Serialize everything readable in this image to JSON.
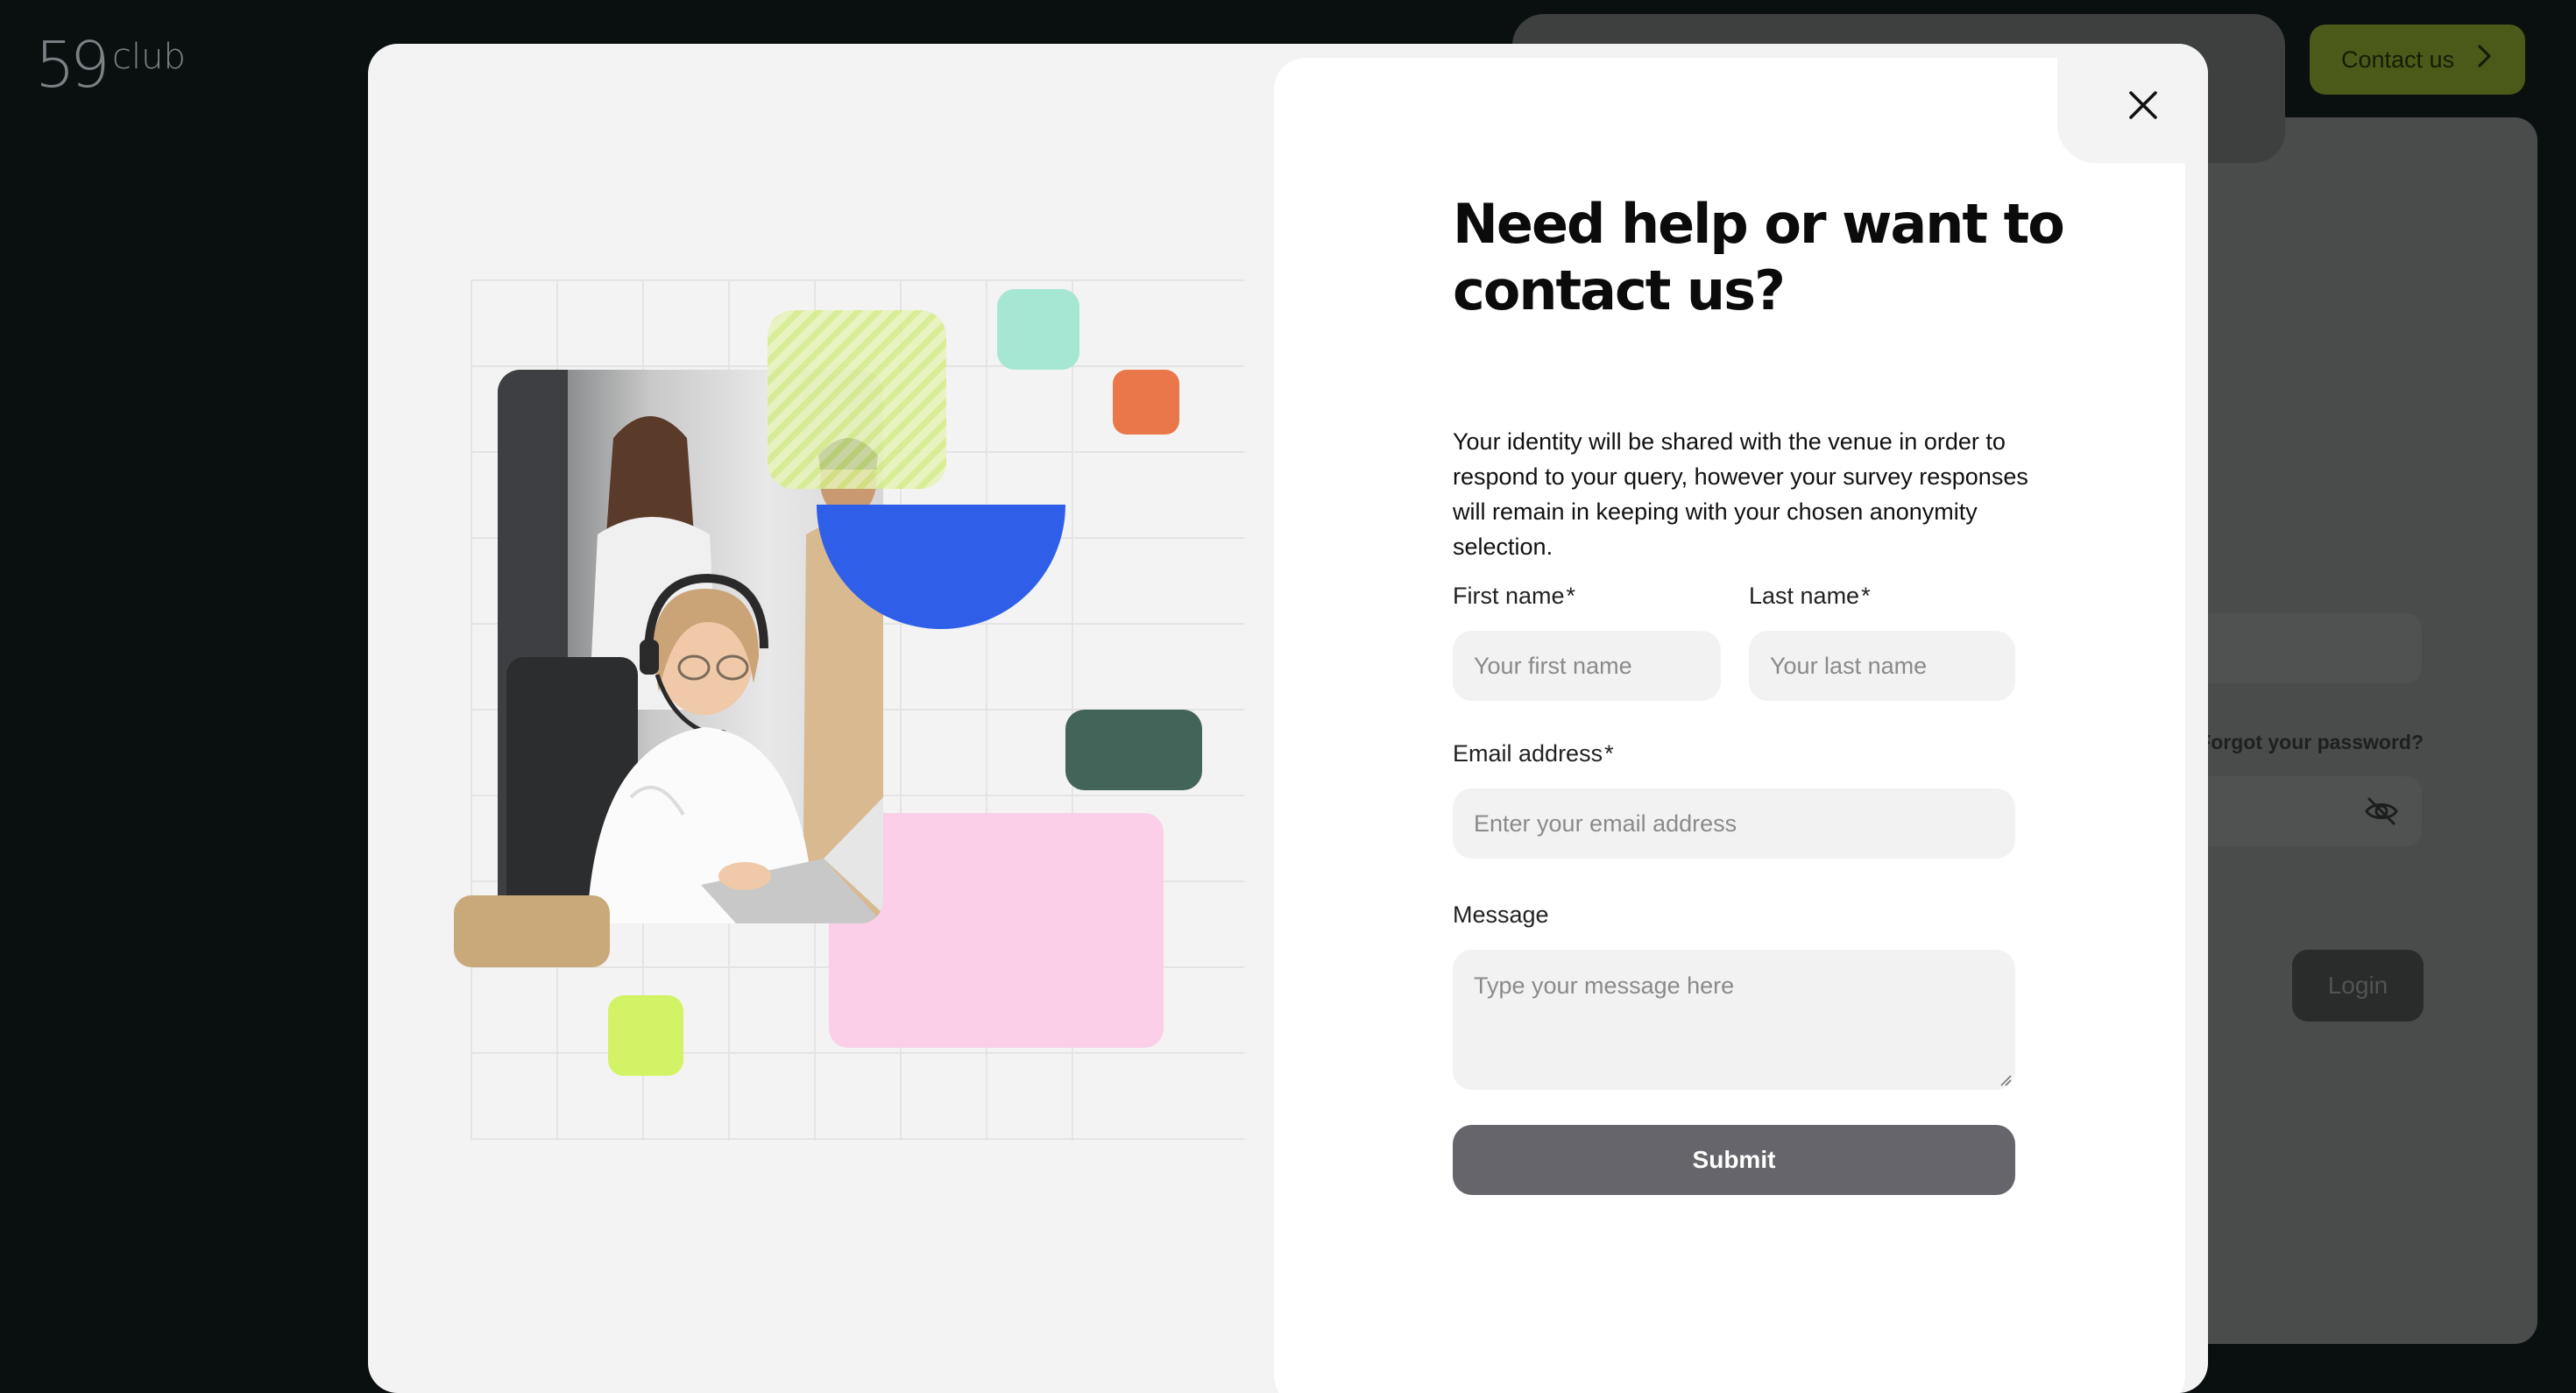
{
  "background": {
    "logo": {
      "number": "59",
      "word": "club"
    },
    "header": {
      "contact_label": "Contact us"
    },
    "login": {
      "forgot_password": "Forgot your password?",
      "login_button": "Login"
    }
  },
  "modal": {
    "title": "Need help or want to contact us?",
    "description": "Your identity will be shared with the venue in order to respond to your query, however your survey responses will remain in keeping with your chosen anonymity selection.",
    "fields": {
      "first_name": {
        "label": "First name",
        "required_mark": "*",
        "placeholder": "Your first name",
        "value": ""
      },
      "last_name": {
        "label": "Last name",
        "required_mark": "*",
        "placeholder": "Your last name",
        "value": ""
      },
      "email": {
        "label": "Email address",
        "required_mark": "*",
        "placeholder": "Enter your email address",
        "value": ""
      },
      "message": {
        "label": "Message",
        "placeholder": "Type your message here",
        "value": ""
      }
    },
    "submit_label": "Submit"
  },
  "colors": {
    "page_background": "#0a1010",
    "modal_background": "#f3f3f3",
    "submit_button": "#65656b",
    "contact_button": "#4b5a19",
    "shape_blue": "#2f5fe8",
    "shape_pink": "#fbcfe8",
    "shape_dark_green": "#436458",
    "shape_orange": "#ea774a",
    "shape_mint": "#a6e7d3",
    "shape_lime": "#d3f366",
    "shape_tan": "#c9a97a"
  },
  "icons": {
    "close": "close-icon",
    "contact_chevron": "chevron-right-icon",
    "password_visibility": "eye-off-icon",
    "illustration_photo": "support-agent-photo"
  }
}
